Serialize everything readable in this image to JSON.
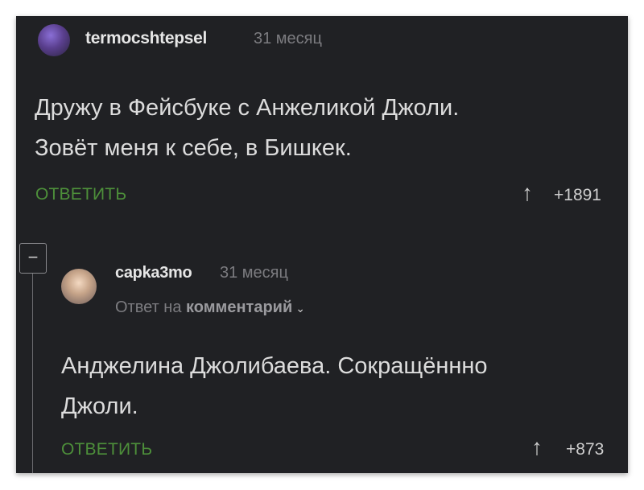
{
  "comment1": {
    "username": "termocshtepsel",
    "time": "31 месяц",
    "text_line1": "Дружу в Фейсбуке с Анжеликой Джоли.",
    "text_line2": "Зовёт меня к себе, в Бишкек.",
    "reply_label": "ОТВЕТИТЬ",
    "score": "+1891"
  },
  "collapse_symbol": "−",
  "comment2": {
    "username": "capka3mo",
    "time": "31 месяц",
    "reply_to_prefix": "Ответ на",
    "reply_to_link": "комментарий",
    "text_line1": "Анджелина Джолибаева. Сокращённно",
    "text_line2": "Джоли.",
    "reply_label": "ОТВЕТИТЬ",
    "score": "+873"
  },
  "icons": {
    "upvote": "arrow-up-icon",
    "chevron": "chevron-down-icon",
    "collapse": "minus-icon"
  },
  "colors": {
    "background": "#202124",
    "reply_button": "#4d8f3a",
    "text": "#dcdcdc",
    "muted": "#7c7c80"
  }
}
